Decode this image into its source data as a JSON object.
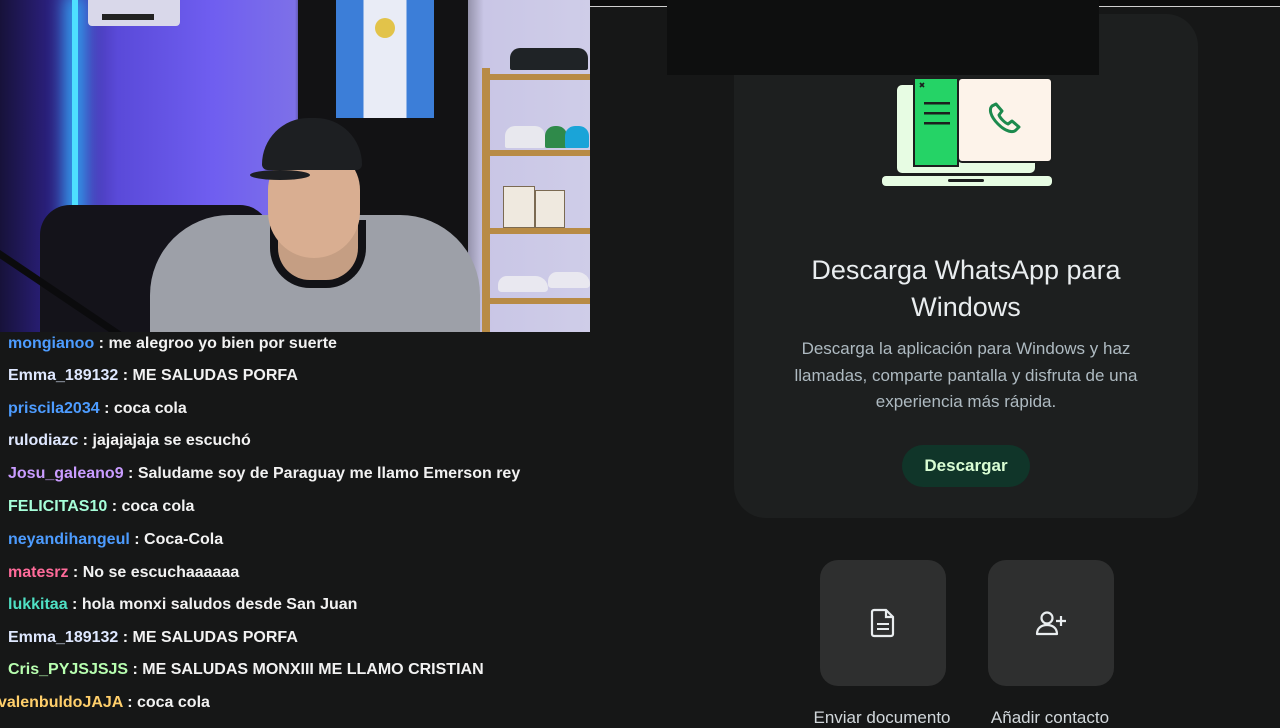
{
  "chat": {
    "messages": [
      {
        "user": "mongianoo",
        "color": "#4d9cff",
        "text": "me alegroo yo bien por suerte"
      },
      {
        "user": "Emma_189132",
        "color": "#dfe8ff",
        "text": "ME SALUDAS PORFA"
      },
      {
        "user": "priscila2034",
        "color": "#4d9cff",
        "text": "coca cola"
      },
      {
        "user": "rulodiazc",
        "color": "#dfe8ff",
        "text": "jajajajaja se escuchó"
      },
      {
        "user": "Josu_galeano9",
        "color": "#c99cff",
        "text": "Saludame soy de Paraguay me llamo Emerson rey"
      },
      {
        "user": "FELICITAS10",
        "color": "#a6ffd9",
        "text": "coca cola"
      },
      {
        "user": "neyandihangeul",
        "color": "#4d9cff",
        "text": "Coca-Cola"
      },
      {
        "user": "matesrz",
        "color": "#ff6b9a",
        "text": "No se escuchaaaaaa"
      },
      {
        "user": "lukkitaa",
        "color": "#4fe0c4",
        "text": "hola monxi saludos desde San Juan"
      },
      {
        "user": "Emma_189132",
        "color": "#dfe8ff",
        "text": "ME SALUDAS PORFA"
      },
      {
        "user": "Cris_PYJSJSJS",
        "color": "#b8ffb0",
        "text": "ME SALUDAS MONXIII ME LLAMO CRISTIAN"
      },
      {
        "user": "valenbuldoJAJA",
        "color": "#ffcf6b",
        "text": "coca cola"
      }
    ]
  },
  "whatsapp": {
    "title_line1": "Descarga WhatsApp para",
    "title_line2": "Windows",
    "desc_line1": "Descarga la aplicación para Windows y haz",
    "desc_line2": "llamadas, comparte pantalla y disfruta de una",
    "desc_line3": "experiencia más rápida.",
    "download_label": "Descargar",
    "illustration_icon": "laptop-phone-icon",
    "actions": [
      {
        "label": "Enviar documento",
        "icon": "document-icon"
      },
      {
        "label": "Añadir contacto",
        "icon": "add-contact-icon"
      }
    ],
    "colors": {
      "accent": "#25d366",
      "button_bg": "#103529",
      "button_text": "#d9fdd3"
    }
  }
}
